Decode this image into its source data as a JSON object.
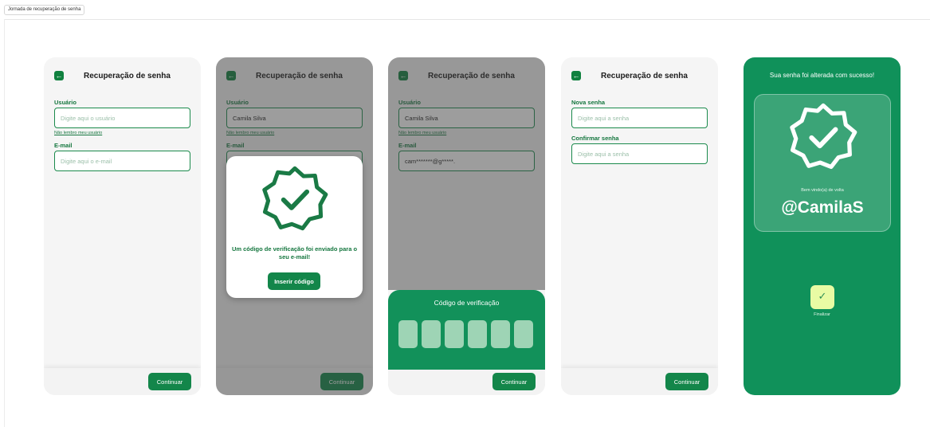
{
  "frame": {
    "tab_label": "Jornada de recuperação de senha"
  },
  "colors": {
    "primary": "#13864a",
    "success_bg": "#10915a",
    "finish_button": "#e9fba4"
  },
  "icons": {
    "back": "arrow-left-icon",
    "badge": "verified-badge-icon",
    "finish": "check-icon"
  },
  "screen1": {
    "title": "Recuperação de senha",
    "user_label": "Usuário",
    "user_placeholder": "Digite aqui o usuário",
    "forgot_link": "Não lembro meu usuário",
    "email_label": "E-mail",
    "email_placeholder": "Digite aqui o e-mail",
    "continue": "Continuar"
  },
  "screen2": {
    "title": "Recuperação de senha",
    "user_label": "Usuário",
    "user_value": "Camila Silva",
    "forgot_link": "Não lembro meu usuário",
    "email_label": "E-mail",
    "modal_text": "Um código de verificação foi enviado para o seu e-mail!",
    "modal_button": "Inserir código",
    "continue": "Continuar"
  },
  "screen3": {
    "title": "Recuperação de senha",
    "user_label": "Usuário",
    "user_value": "Camila Silva",
    "forgot_link": "Não lembro meu usuário",
    "email_label": "E-mail",
    "email_value": "cam*******@g*****.",
    "code_title": "Código de verificação",
    "code_digits": [
      "",
      "",
      "",
      "",
      "",
      ""
    ],
    "continue": "Continuar"
  },
  "screen4": {
    "title": "Recuperação de senha",
    "new_pass_label": "Nova senha",
    "new_pass_placeholder": "Digite aqui a senha",
    "confirm_label": "Confirmar senha",
    "confirm_placeholder": "Digite aqui a senha",
    "continue": "Continuar"
  },
  "screen5": {
    "title": "Sua senha foi alterada com sucesso!",
    "welcome": "Bem vindo(a) de volta",
    "username": "@CamilaS",
    "finish_label": "Finalizar"
  }
}
